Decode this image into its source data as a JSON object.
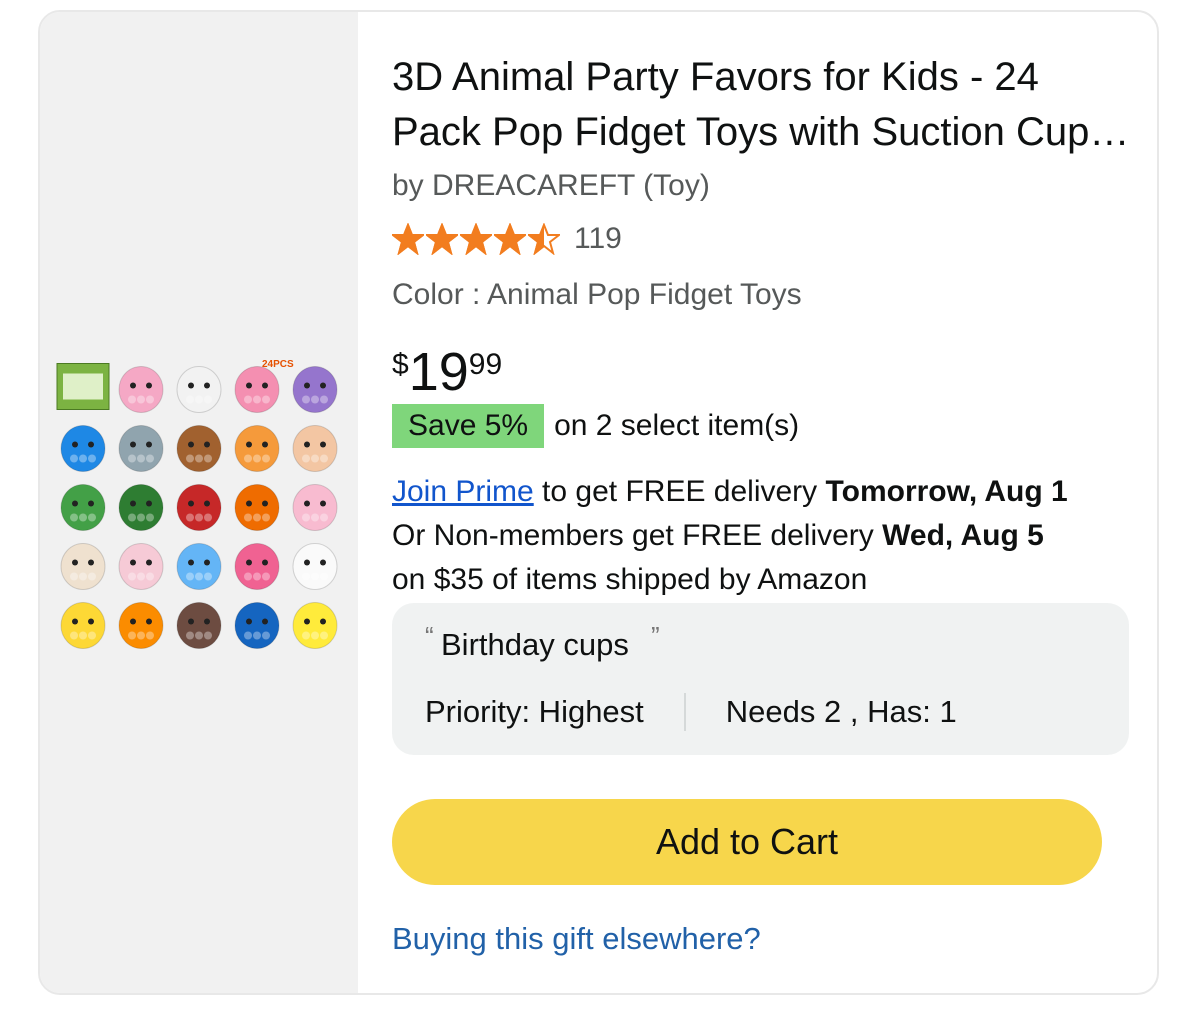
{
  "product": {
    "title": "3D Animal Party Favors for Kids - 24 Pack Pop Fidget Toys with Suction Cup Squeeze Toys",
    "byline": "by DREACAREFT (Toy)",
    "rating": 4.5,
    "review_count": "119",
    "color_line": "Color : Animal Pop Fidget Toys",
    "price": {
      "symbol": "$",
      "whole": "19",
      "fraction": "99"
    },
    "save_badge": "Save 5%",
    "save_text": "on 2 select item(s)",
    "image_badge": "24PCS"
  },
  "delivery": {
    "join_prime": "Join Prime",
    "line1_rest": " to get FREE delivery ",
    "line1_bold": "Tomorrow, Aug 1",
    "line2_plain": "Or Non-members get FREE delivery ",
    "line2_bold": "Wed, Aug 5",
    "line3": "on $35 of items shipped by Amazon"
  },
  "list_item": {
    "comment": "Birthday cups",
    "priority": "Priority: Highest",
    "needs_has": "Needs 2 , Has: 1"
  },
  "actions": {
    "add_to_cart": "Add to Cart",
    "buying_elsewhere": "Buying this gift elsewhere?"
  },
  "colors": {
    "star": "#f27d1f",
    "save_badge": "#7fd67b",
    "add_to_cart": "#f7d64b",
    "link": "#2161a8",
    "join_prime": "#1155cc"
  },
  "image_toys": [
    {
      "name": "box",
      "color": "#7cb342"
    },
    {
      "name": "bunny-pink",
      "color": "#f5a8c5"
    },
    {
      "name": "bunny-white",
      "color": "#f2f2f2"
    },
    {
      "name": "unicorn-pink",
      "color": "#f48fb1"
    },
    {
      "name": "unicorn-purple",
      "color": "#9575cd"
    },
    {
      "name": "shark-blue",
      "color": "#1e88e5"
    },
    {
      "name": "shark-grey",
      "color": "#90a4ae"
    },
    {
      "name": "lion-brown",
      "color": "#a1612f"
    },
    {
      "name": "lion-orange",
      "color": "#f59a3b"
    },
    {
      "name": "pig-tan",
      "color": "#f3c6a3"
    },
    {
      "name": "frog-green",
      "color": "#43a047"
    },
    {
      "name": "frog-dark",
      "color": "#2e7d32"
    },
    {
      "name": "fox-red",
      "color": "#c62828"
    },
    {
      "name": "fox-orange",
      "color": "#ef6c00"
    },
    {
      "name": "pig-pink",
      "color": "#f8bbd0"
    },
    {
      "name": "dog-cream",
      "color": "#efe1cf"
    },
    {
      "name": "dog-pink",
      "color": "#f6cad6"
    },
    {
      "name": "elephant-blue",
      "color": "#64b5f6"
    },
    {
      "name": "pig-hotpink",
      "color": "#f06292"
    },
    {
      "name": "chicken-white",
      "color": "#fafafa"
    },
    {
      "name": "bee-yellow",
      "color": "#fdd835"
    },
    {
      "name": "bee-orange",
      "color": "#fb8c00"
    },
    {
      "name": "monkey-brown",
      "color": "#6d4c41"
    },
    {
      "name": "monkey-blue",
      "color": "#1565c0"
    },
    {
      "name": "chick-yellow",
      "color": "#ffeb3b"
    }
  ]
}
